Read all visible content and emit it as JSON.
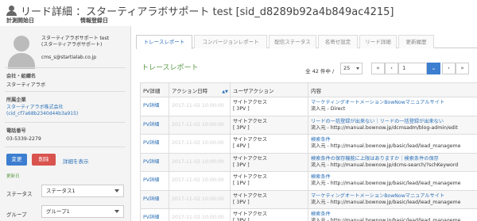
{
  "header": {
    "title": "リード詳細 ：スターティアラボサポート test [sid_d8289b92a4b849ac4215]",
    "registered_label": "計測開始日",
    "info_label": "情報登録日"
  },
  "profile": {
    "name_line1": "スターティアラボサポート test",
    "name_line2": "(スターティアラボサポート)",
    "email": "cms_s@startialab.co.jp",
    "company_label": "会社・組織名",
    "company_value": "スターティアラボ",
    "affiliation_label": "所属企業",
    "affiliation_value": "スターティアラボ株式会社(cid_cf7a68b2340d44b3a915)",
    "phone_label": "電話番号",
    "phone_value": "03-5339-2279",
    "edit_button": "変更",
    "delete_button": "削除",
    "show_link": "詳細を表示",
    "updated_label": "更新日",
    "status_label": "ステータス",
    "status_value": "ステータス1",
    "group_label": "グループ",
    "group_value": "グループ1"
  },
  "tabs": [
    {
      "label": "トレースレポート"
    },
    {
      "label": "コンバージョンレポート"
    },
    {
      "label": "配信ステータス"
    },
    {
      "label": "名寄せ設定"
    },
    {
      "label": "リード詳細"
    },
    {
      "label": "更新履歴"
    }
  ],
  "report": {
    "title": "トレースレポート",
    "count_text": "全 42 件中 /",
    "per_page": "25",
    "page_value": "1",
    "pager": {
      "first": "«",
      "prev": "‹",
      "next": "›",
      "last": "»"
    }
  },
  "table": {
    "headers": [
      "PV詳細",
      "アクション日時",
      "ユーザアクション",
      "内容"
    ],
    "rows": [
      {
        "pv": "PV詳細",
        "time": "2017-11-02 10:00:00",
        "action": "サイトアクセス",
        "pv_count": "[ 3PV ]",
        "content_link": "マーケティングオートメーションBowNowマニュアルサイト",
        "content_ref": "流入元 - Direct"
      },
      {
        "pv": "PV詳細",
        "time": "2017-11-02 10:00:00",
        "action": "サイトアクセス",
        "pv_count": "[ 3PV ]",
        "content_link": "リードの一括登録が出来ない｜リードの一括登録が出来ない",
        "content_ref": "流入元 - http://manual.bownow.jp/dcmsadm/blog-admin/edit"
      },
      {
        "pv": "PV詳細",
        "time": "2017-11-02 10:00:00",
        "action": "サイトアクセス",
        "pv_count": "[ 4PV ]",
        "content_link": "検索条件",
        "content_ref": "流入元 - http://manual.bownow.jp/basic/lead/lead_manageme"
      },
      {
        "pv": "PV詳細",
        "time": "2017-11-02 10:00:00",
        "action": "サイトアクセス",
        "pv_count": "[ 3PV ]",
        "content_link": "検索条件の保存機能に上限はありますか｜検索条件の保存",
        "content_ref": "流入元 - http://manual.bownow.jp/dcms-search/?schKeyword"
      },
      {
        "pv": "PV詳細",
        "time": "2017-11-02 10:00:00",
        "action": "サイトアクセス",
        "pv_count": "[ 1PV ]",
        "content_link": "検索条件",
        "content_ref": "流入元 - http://manual.bownow.jp/basic/lead/lead_manageme"
      },
      {
        "pv": "PV詳細",
        "time": "2017-11-02 10:00:00",
        "action": "サイトアクセス",
        "pv_count": "[ 3PV ]",
        "content_link": "マーケティングオートメーションBowNowマニュアルサイト",
        "content_ref": "流入元 - http://manual.bownow.jp/basic/lead/lead_manageme"
      },
      {
        "pv": "PV詳細",
        "time": "2017-11-02 10:00:00",
        "action": "サイトアクセス",
        "pv_count": "[ 3PV ]",
        "content_link": "検索条件",
        "content_ref": "流入元 - http://manual.bownow.jp/basic/lead/lead_manageme"
      }
    ]
  }
}
